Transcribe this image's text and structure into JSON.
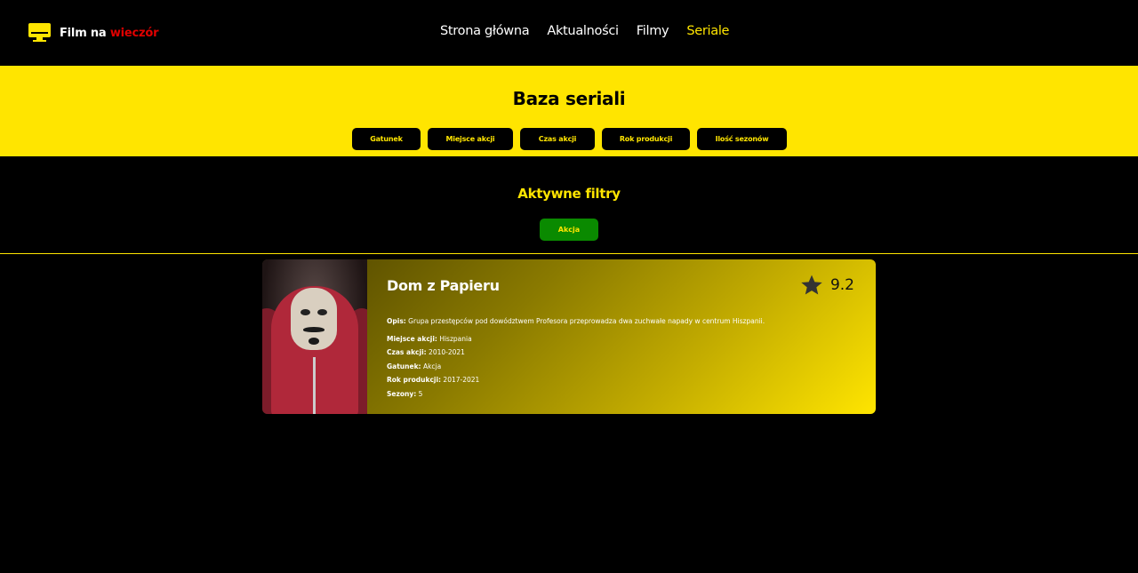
{
  "header": {
    "logo": {
      "part1": "Film na",
      "part2": "wieczór"
    },
    "nav": [
      {
        "label": "Strona główna",
        "active": false
      },
      {
        "label": "Aktualności",
        "active": false
      },
      {
        "label": "Filmy",
        "active": false
      },
      {
        "label": "Seriale",
        "active": true
      }
    ]
  },
  "banner": {
    "title": "Baza seriali",
    "filters": [
      "Gatunek",
      "Miejsce akcji",
      "Czas akcji",
      "Rok produkcji",
      "Ilość sezonów"
    ]
  },
  "active_filters": {
    "title": "Aktywne filtry",
    "chips": [
      "Akcja"
    ]
  },
  "show": {
    "title": "Dom z Papieru",
    "rating": "9.2",
    "description_label": "Opis:",
    "description": "Grupa przestępców pod dowództwem Profesora przeprowadza dwa zuchwałe napady w centrum Hiszpanii.",
    "details": [
      {
        "label": "Miejsce akcji:",
        "value": "Hiszpania"
      },
      {
        "label": "Czas akcji:",
        "value": "2010-2021"
      },
      {
        "label": "Gatunek:",
        "value": "Akcja"
      },
      {
        "label": "Rok produkcji:",
        "value": "2017-2021"
      },
      {
        "label": "Sezony:",
        "value": "5"
      }
    ]
  },
  "colors": {
    "accent": "#FFE500",
    "logo_accent": "#E00000",
    "chip": "#0A8A00",
    "background": "#000000"
  }
}
